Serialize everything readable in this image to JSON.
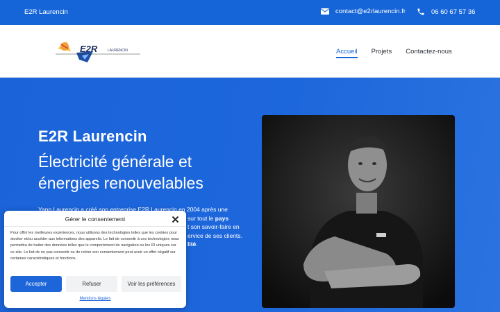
{
  "topbar": {
    "brand": "E2R Laurencin",
    "email": "contact@e2rlaurencin.fr",
    "phone": "06 60 67 57 36",
    "email_icon": "envelope-icon",
    "phone_icon": "phone-icon",
    "color": "#1565d8"
  },
  "header": {
    "logo_text": "E2R",
    "logo_subtext": "LAURENCIN",
    "nav": [
      {
        "label": "Accueil",
        "active": true
      },
      {
        "label": "Projets",
        "active": false
      },
      {
        "label": "Contactez-nous",
        "active": false
      }
    ]
  },
  "hero": {
    "title": "E2R Laurencin",
    "subtitle": "Électricité générale et énergies renouvelables",
    "body_parts": [
      "Yann Laurencin a créé son entreprise E2R Laurencin en 2004 après une",
      "sur tout le",
      "pays",
      "t son savoir-faire en",
      "ervice de ses clients.",
      "lité",
      "."
    ],
    "photo_alt": "portrait photo",
    "background": "#1b63d9"
  },
  "cookie": {
    "title": "Gérer le consentement",
    "text": "Pour offrir les meilleures expériences, nous utilisons des technologies telles que les cookies pour stocker et/ou accéder aux informations des appareils. Le fait de consentir à ces technologies nous permettra de traiter des données telles que le comportement de navigation ou les ID uniques sur ce site. Le fait de ne pas consentir ou de retirer son consentement peut avoir un effet négatif sur certaines caractéristiques et fonctions.",
    "accept": "Accepter",
    "refuse": "Refuser",
    "preferences": "Voir les préférences",
    "legal": "Mentions légales",
    "close_icon": "close-icon",
    "accent": "#1d66da"
  }
}
